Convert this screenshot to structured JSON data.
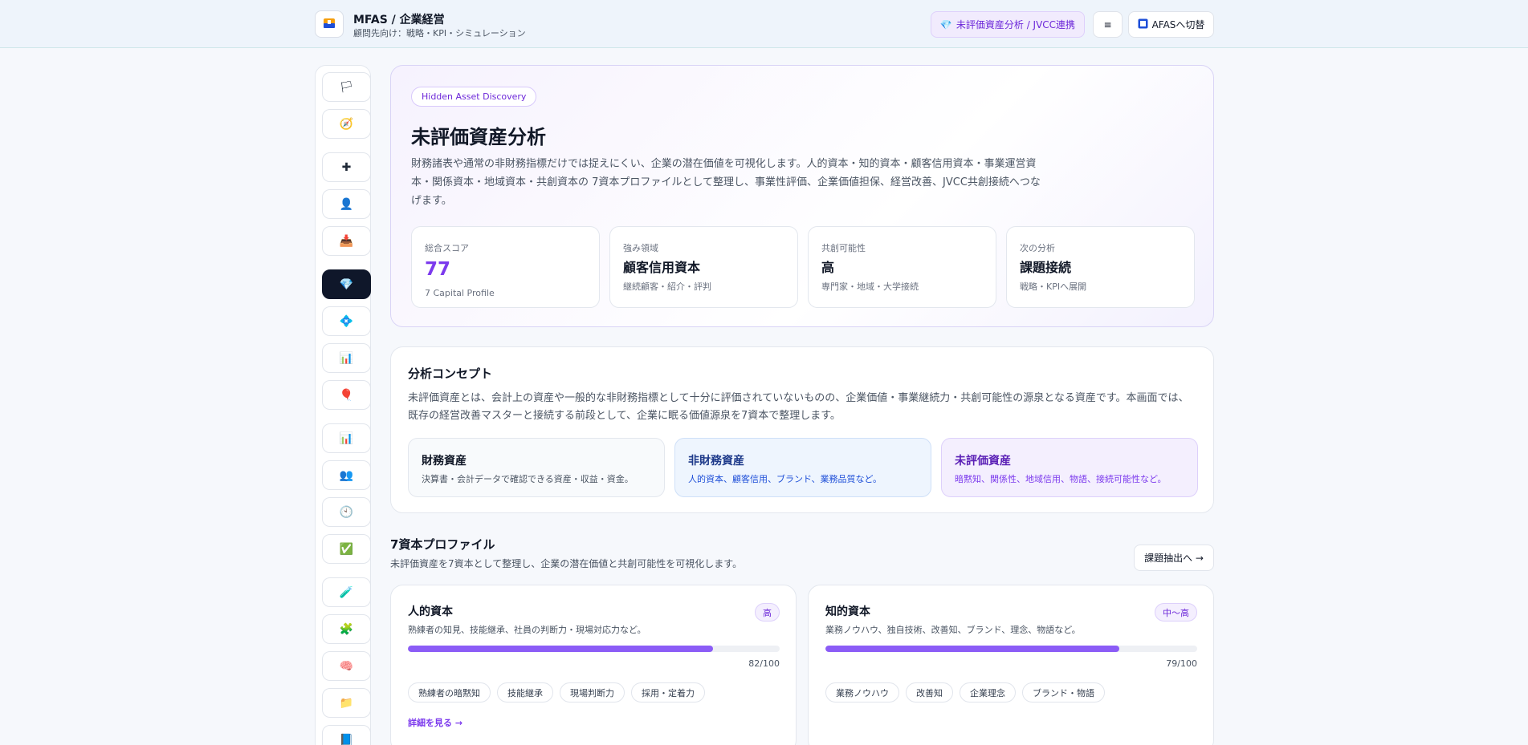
{
  "header": {
    "title": "MFAS / 企業経営",
    "subtitle": "顧問先向け：戦略・KPI・シミュレーション",
    "primary_button": "未評価資産分析 / JVCC連携",
    "menu_icon": "≡",
    "switch_button": "AFASへ切替",
    "accent": "#7c3aed"
  },
  "sidebar": {
    "items": [
      {
        "icon": "flag-icon",
        "glyph": "🏳"
      },
      {
        "icon": "compass-icon",
        "glyph": "🧭"
      },
      {
        "icon": "plus-icon",
        "glyph": "✚"
      },
      {
        "icon": "user-icon",
        "glyph": "👤"
      },
      {
        "icon": "stamp-icon",
        "glyph": "📥"
      },
      {
        "icon": "gem-icon",
        "glyph": "💎",
        "active": true
      },
      {
        "icon": "diamond-icon",
        "glyph": "💠"
      },
      {
        "icon": "bar-chart-icon",
        "glyph": "📊"
      },
      {
        "icon": "balloon-icon",
        "glyph": "🎈"
      },
      {
        "icon": "chart-icon",
        "glyph": "📊"
      },
      {
        "icon": "people-icon",
        "glyph": "👥"
      },
      {
        "icon": "clock-icon",
        "glyph": "🕙"
      },
      {
        "icon": "check-icon",
        "glyph": "✅"
      },
      {
        "icon": "test-tube-icon",
        "glyph": "🧪"
      },
      {
        "icon": "puzzle-icon",
        "glyph": "🧩"
      },
      {
        "icon": "brain-icon",
        "glyph": "🧠"
      },
      {
        "icon": "folder-icon",
        "glyph": "📁"
      },
      {
        "icon": "book-icon",
        "glyph": "📘"
      }
    ]
  },
  "hero": {
    "pill": "Hidden Asset Discovery",
    "title": "未評価資産分析",
    "description": "財務諸表や通常の非財務指標だけでは捉えにくい、企業の潜在価値を可視化します。人的資本・知的資本・顧客信用資本・事業運営資本・関係資本・地域資本・共創資本の 7資本プロファイルとして整理し、事業性評価、企業価値担保、経営改善、JVCC共創接続へつなげます。",
    "kpis": [
      {
        "label": "総合スコア",
        "value": "77",
        "sub": "7 Capital Profile"
      },
      {
        "label": "強み領域",
        "value": "顧客信用資本",
        "sub": "継続顧客・紹介・評判"
      },
      {
        "label": "共創可能性",
        "value": "高",
        "sub": "専門家・地域・大学接続"
      },
      {
        "label": "次の分析",
        "value": "課題接続",
        "sub": "戦略・KPIへ展開"
      }
    ]
  },
  "concept": {
    "title": "分析コンセプト",
    "description": "未評価資産とは、会計上の資産や一般的な非財務指標として十分に評価されていないものの、企業価値・事業継続力・共創可能性の源泉となる資産です。本画面では、既存の経営改善マスターと接続する前段として、企業に眠る価値源泉を7資本で整理します。",
    "assets": [
      {
        "title": "財務資産",
        "desc": "決算書・会計データで確認できる資産・収益・資金。"
      },
      {
        "title": "非財務資産",
        "desc": "人的資本、顧客信用、ブランド、業務品質など。"
      },
      {
        "title": "未評価資産",
        "desc": "暗黙知、関係性、地域信用、物語、接続可能性など。"
      }
    ]
  },
  "profile": {
    "title": "7資本プロファイル",
    "subtitle": "未評価資産を7資本として整理し、企業の潜在価値と共創可能性を可視化します。",
    "button": "課題抽出へ →",
    "cards": [
      {
        "title": "人的資本",
        "badge": "高",
        "desc": "熟練者の知見、技能継承、社員の判断力・現場対応力など。",
        "score": 82,
        "score_label": "82/100",
        "tags": [
          "熟練者の暗黙知",
          "技能継承",
          "現場判断力",
          "採用・定着力"
        ],
        "link": "詳細を見る →"
      },
      {
        "title": "知的資本",
        "badge": "中〜高",
        "desc": "業務ノウハウ、独自技術、改善知、ブランド、理念、物語など。",
        "score": 79,
        "score_label": "79/100",
        "tags": [
          "業務ノウハウ",
          "改善知",
          "企業理念",
          "ブランド・物語"
        ]
      }
    ]
  }
}
